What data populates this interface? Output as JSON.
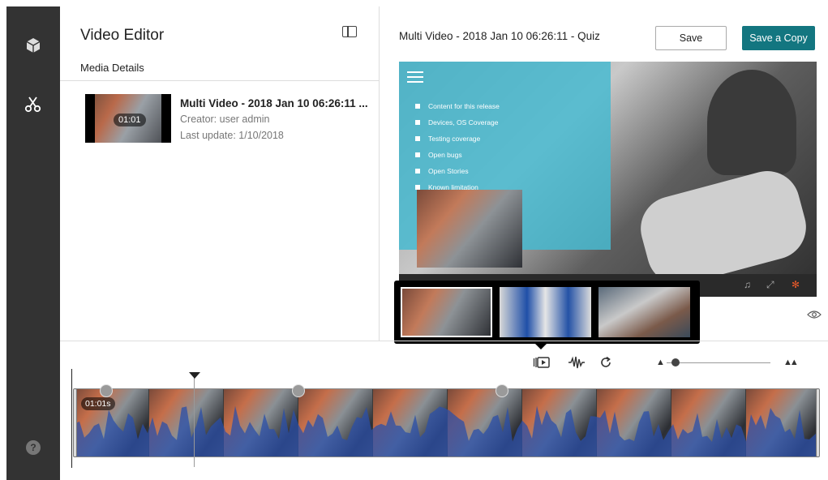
{
  "sidebar": {
    "items": [
      {
        "icon": "cube-icon"
      },
      {
        "icon": "scissors-icon"
      }
    ],
    "help_label": "?"
  },
  "editor": {
    "title": "Video Editor",
    "section_label": "Media Details"
  },
  "media": {
    "name": "Multi Video - 2018 Jan 10 06:26:11 ...",
    "duration": "01:01",
    "creator": "Creator: user admin",
    "last_update": "Last update: 1/10/2018"
  },
  "preview": {
    "video_title": "Multi Video - 2018 Jan 10 06:26:11 - Quiz",
    "save_label": "Save",
    "save_copy_label": "Save a Copy",
    "slide_items": [
      "Content for this release",
      "Devices, OS Coverage",
      "Testing coverage",
      "Open bugs",
      "Open Stories",
      "Known limitation"
    ]
  },
  "timeline": {
    "time_label": "01:01s",
    "zoom_level": 0.05
  },
  "colors": {
    "sidebar": "#333333",
    "accent": "#137680",
    "slides_overlay": "#48bad0",
    "waveform": "#2b4fa8"
  }
}
